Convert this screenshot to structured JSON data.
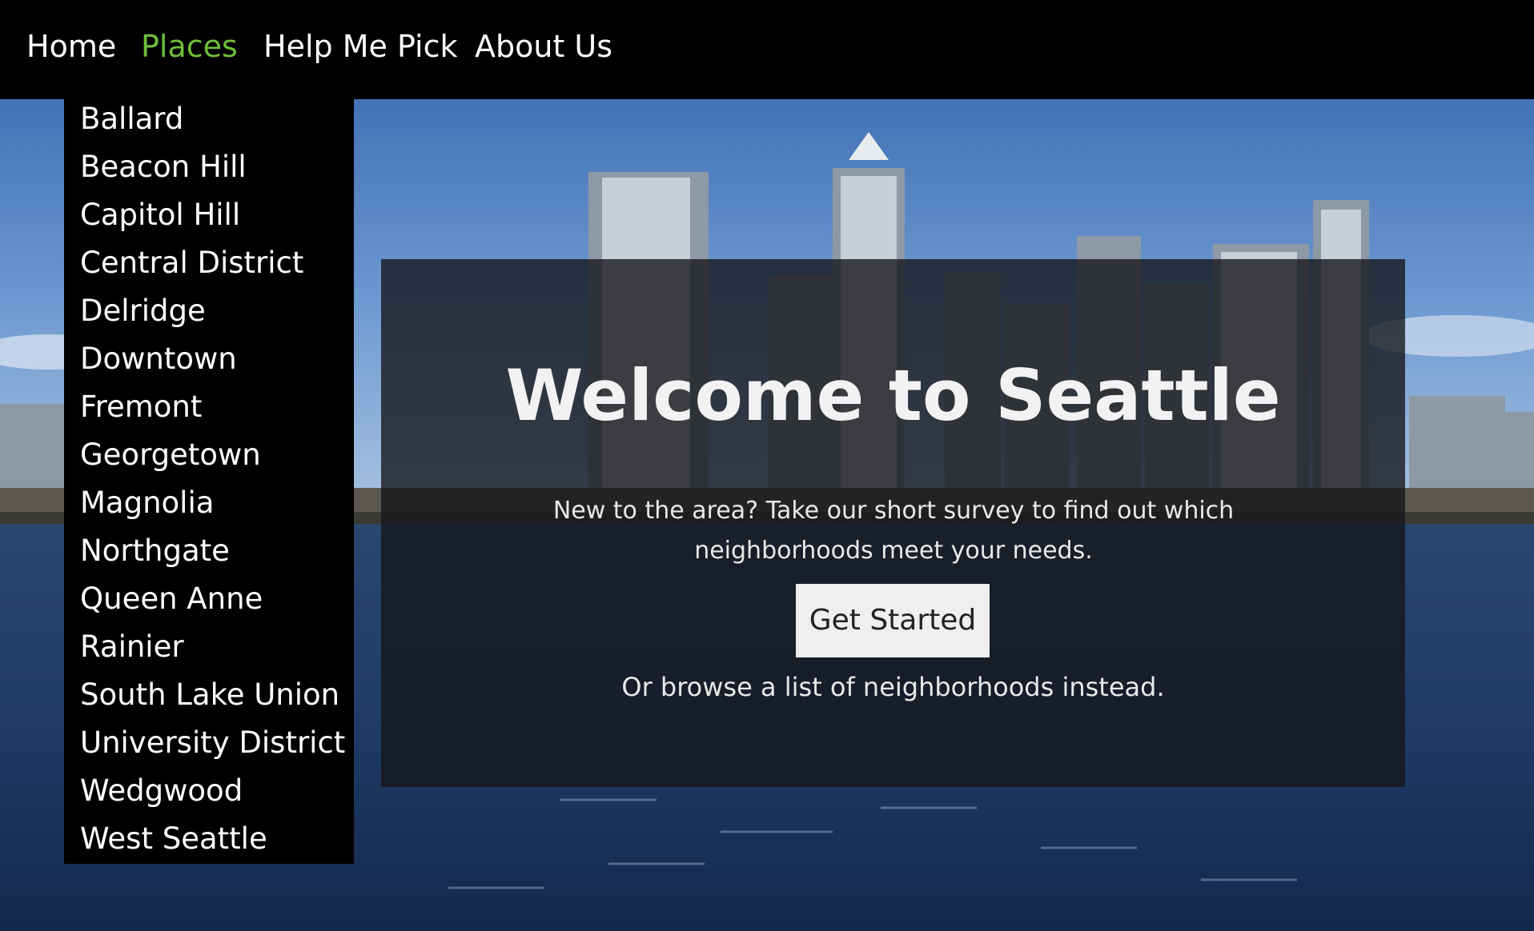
{
  "nav": {
    "items": [
      {
        "label": "Home",
        "active": false
      },
      {
        "label": "Places",
        "active": true
      },
      {
        "label": "Help Me Pick",
        "active": false
      },
      {
        "label": "About Us",
        "active": false
      }
    ],
    "active_color": "#6fbe3a"
  },
  "places_dropdown": {
    "items": [
      "Ballard",
      "Beacon Hill",
      "Capitol Hill",
      "Central District",
      "Delridge",
      "Downtown",
      "Fremont",
      "Georgetown",
      "Magnolia",
      "Northgate",
      "Queen Anne",
      "Rainier",
      "South Lake Union",
      "University District",
      "Wedgwood",
      "West Seattle"
    ]
  },
  "hero": {
    "title": "Welcome to Seattle",
    "description": "New to the area? Take our short survey to find out which neighborhoods meet your needs.",
    "cta_label": "Get Started",
    "alt_link": "Or browse a list of neighborhoods instead."
  }
}
